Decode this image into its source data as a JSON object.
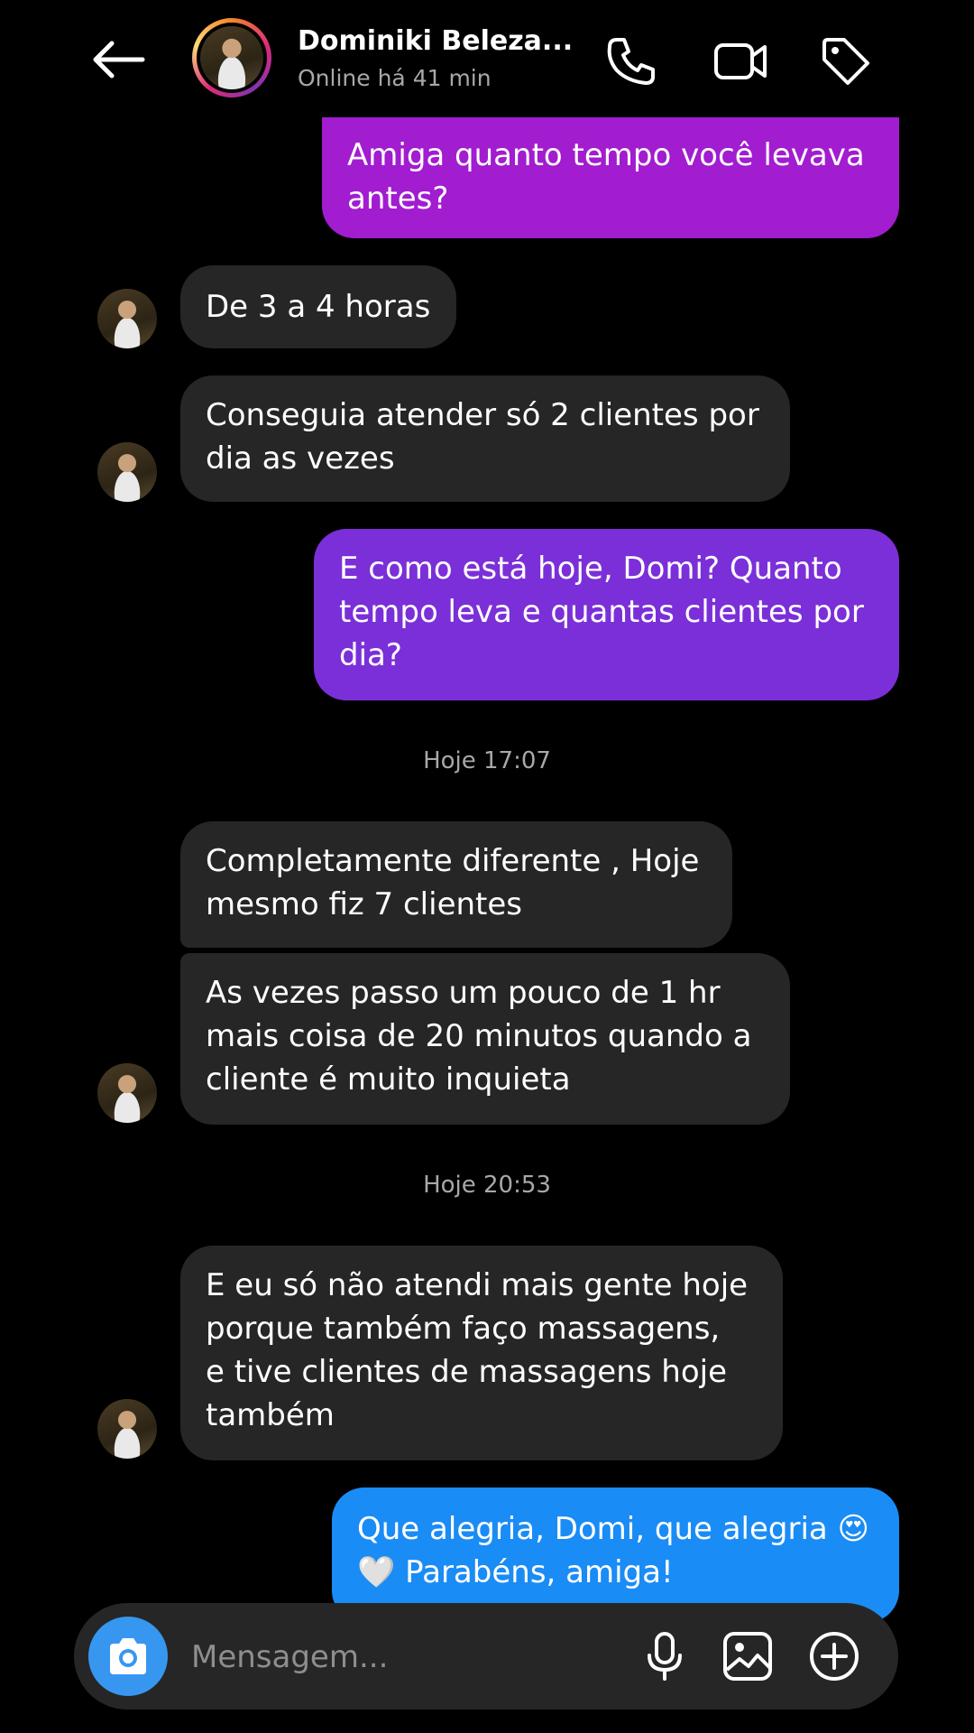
{
  "header": {
    "name": "Dominiki Beleza...",
    "status": "Online há 41 min"
  },
  "messages": [
    {
      "text": "Amiga quanto tempo você levava\nantes?"
    },
    {
      "text": "De 3 a 4 horas"
    },
    {
      "text": "Conseguia atender só 2 clientes por\ndia as vezes"
    },
    {
      "text": "E como está hoje, Domi? Quanto\ntempo leva e quantas clientes por\ndia?"
    },
    {
      "text": "Completamente diferente , Hoje\nmesmo fiz 7 clientes"
    },
    {
      "text": "As vezes passo um pouco de 1 hr\nmais coisa de 20 minutos quando a\ncliente é muito inquieta"
    },
    {
      "text": "E eu só não atendi mais gente hoje\nporque também faço massagens,\ne tive clientes de massagens hoje\ntambém"
    },
    {
      "text": "Que alegria, Domi, que alegria 😍\n🤍 Parabéns, amiga!"
    }
  ],
  "timestamps": [
    "Hoje 17:07",
    "Hoje 20:53"
  ],
  "composer": {
    "placeholder": "Mensagem..."
  },
  "colors": {
    "bg": "#000000",
    "incoming_bubble": "#262626",
    "outgoing_gradient": [
      "#a21cd0",
      "#7b2fd8",
      "#3d6df0",
      "#1a8cf5"
    ],
    "accent": "#3797f0"
  },
  "icons": [
    "back-arrow-icon",
    "phone-icon",
    "video-camera-icon",
    "tag-icon",
    "camera-icon",
    "microphone-icon",
    "gallery-icon",
    "plus-circle-icon"
  ]
}
